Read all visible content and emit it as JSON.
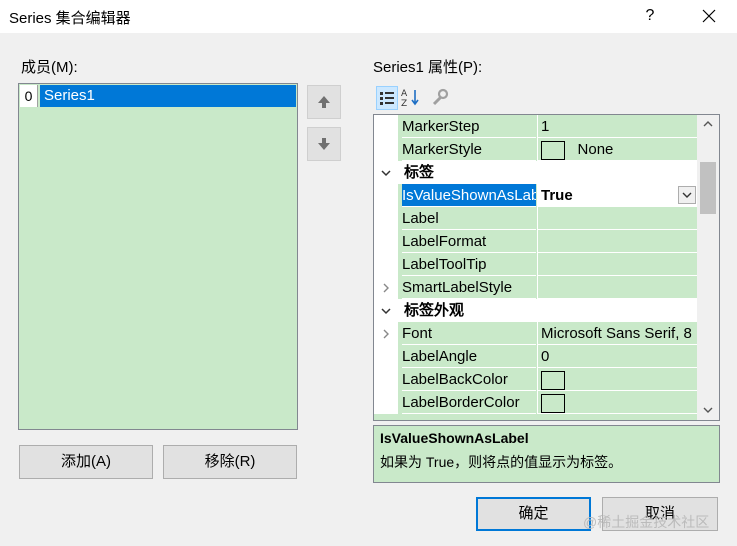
{
  "window": {
    "title": "Series 集合编辑器",
    "help_label": "?",
    "close_icon": "close-icon"
  },
  "members": {
    "label": "成员(M):",
    "items": [
      {
        "index": "0",
        "name": "Series1",
        "selected": true
      }
    ],
    "add_label": "添加(A)",
    "remove_label": "移除(R)"
  },
  "properties": {
    "label": "Series1 属性(P):",
    "toolbar": [
      "categorized-icon",
      "alphabetical-icon",
      "property-pages-icon"
    ],
    "rows": [
      {
        "type": "prop",
        "name": "MarkerStep",
        "value": "1"
      },
      {
        "type": "prop",
        "name": "MarkerStyle",
        "value": "None",
        "swatch": true
      },
      {
        "type": "category",
        "name": "标签",
        "expanded": true
      },
      {
        "type": "prop",
        "name": "IsValueShownAsLabel",
        "value": "True",
        "selected": true
      },
      {
        "type": "prop",
        "name": "Label",
        "value": ""
      },
      {
        "type": "prop",
        "name": "LabelFormat",
        "value": ""
      },
      {
        "type": "prop",
        "name": "LabelToolTip",
        "value": ""
      },
      {
        "type": "prop",
        "name": "SmartLabelStyle",
        "value": "",
        "expandable": true
      },
      {
        "type": "category",
        "name": "标签外观",
        "expanded": true
      },
      {
        "type": "prop",
        "name": "Font",
        "value": "Microsoft Sans Serif, 8",
        "expandable": true
      },
      {
        "type": "prop",
        "name": "LabelAngle",
        "value": "0"
      },
      {
        "type": "prop",
        "name": "LabelBackColor",
        "value": "",
        "swatch": true
      },
      {
        "type": "prop",
        "name": "LabelBorderColor",
        "value": "",
        "swatch": true
      }
    ]
  },
  "description": {
    "title": "IsValueShownAsLabel",
    "text": "如果为 True，则将点的值显示为标签。"
  },
  "footer": {
    "ok_label": "确定",
    "cancel_label": "取消"
  },
  "watermark": "@稀土掘金技术社区",
  "colors": {
    "list_background": "#c9e9c9",
    "selection": "#0078d7",
    "dialog_background": "#f0f0f0"
  }
}
